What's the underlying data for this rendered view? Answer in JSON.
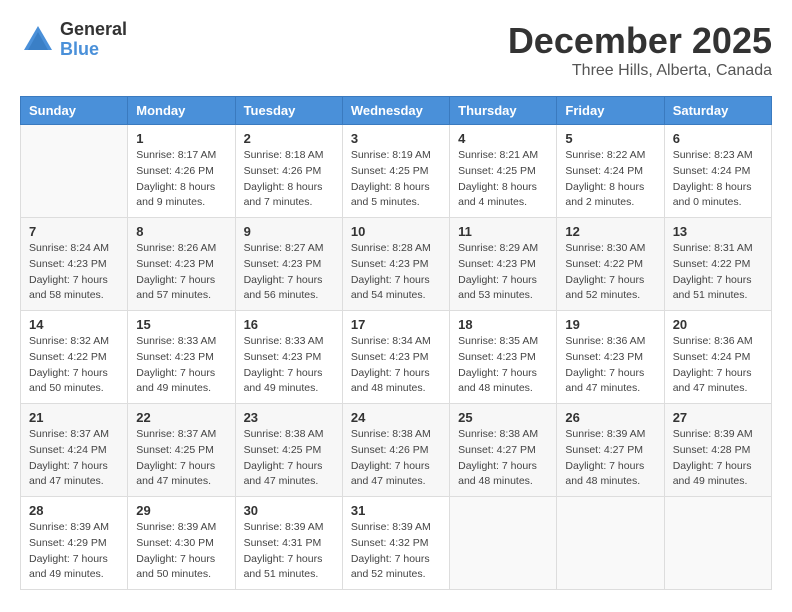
{
  "logo": {
    "general": "General",
    "blue": "Blue"
  },
  "title": "December 2025",
  "location": "Three Hills, Alberta, Canada",
  "days_of_week": [
    "Sunday",
    "Monday",
    "Tuesday",
    "Wednesday",
    "Thursday",
    "Friday",
    "Saturday"
  ],
  "weeks": [
    [
      {
        "day": "",
        "info": ""
      },
      {
        "day": "1",
        "info": "Sunrise: 8:17 AM\nSunset: 4:26 PM\nDaylight: 8 hours\nand 9 minutes."
      },
      {
        "day": "2",
        "info": "Sunrise: 8:18 AM\nSunset: 4:26 PM\nDaylight: 8 hours\nand 7 minutes."
      },
      {
        "day": "3",
        "info": "Sunrise: 8:19 AM\nSunset: 4:25 PM\nDaylight: 8 hours\nand 5 minutes."
      },
      {
        "day": "4",
        "info": "Sunrise: 8:21 AM\nSunset: 4:25 PM\nDaylight: 8 hours\nand 4 minutes."
      },
      {
        "day": "5",
        "info": "Sunrise: 8:22 AM\nSunset: 4:24 PM\nDaylight: 8 hours\nand 2 minutes."
      },
      {
        "day": "6",
        "info": "Sunrise: 8:23 AM\nSunset: 4:24 PM\nDaylight: 8 hours\nand 0 minutes."
      }
    ],
    [
      {
        "day": "7",
        "info": "Sunrise: 8:24 AM\nSunset: 4:23 PM\nDaylight: 7 hours\nand 58 minutes."
      },
      {
        "day": "8",
        "info": "Sunrise: 8:26 AM\nSunset: 4:23 PM\nDaylight: 7 hours\nand 57 minutes."
      },
      {
        "day": "9",
        "info": "Sunrise: 8:27 AM\nSunset: 4:23 PM\nDaylight: 7 hours\nand 56 minutes."
      },
      {
        "day": "10",
        "info": "Sunrise: 8:28 AM\nSunset: 4:23 PM\nDaylight: 7 hours\nand 54 minutes."
      },
      {
        "day": "11",
        "info": "Sunrise: 8:29 AM\nSunset: 4:23 PM\nDaylight: 7 hours\nand 53 minutes."
      },
      {
        "day": "12",
        "info": "Sunrise: 8:30 AM\nSunset: 4:22 PM\nDaylight: 7 hours\nand 52 minutes."
      },
      {
        "day": "13",
        "info": "Sunrise: 8:31 AM\nSunset: 4:22 PM\nDaylight: 7 hours\nand 51 minutes."
      }
    ],
    [
      {
        "day": "14",
        "info": "Sunrise: 8:32 AM\nSunset: 4:22 PM\nDaylight: 7 hours\nand 50 minutes."
      },
      {
        "day": "15",
        "info": "Sunrise: 8:33 AM\nSunset: 4:23 PM\nDaylight: 7 hours\nand 49 minutes."
      },
      {
        "day": "16",
        "info": "Sunrise: 8:33 AM\nSunset: 4:23 PM\nDaylight: 7 hours\nand 49 minutes."
      },
      {
        "day": "17",
        "info": "Sunrise: 8:34 AM\nSunset: 4:23 PM\nDaylight: 7 hours\nand 48 minutes."
      },
      {
        "day": "18",
        "info": "Sunrise: 8:35 AM\nSunset: 4:23 PM\nDaylight: 7 hours\nand 48 minutes."
      },
      {
        "day": "19",
        "info": "Sunrise: 8:36 AM\nSunset: 4:23 PM\nDaylight: 7 hours\nand 47 minutes."
      },
      {
        "day": "20",
        "info": "Sunrise: 8:36 AM\nSunset: 4:24 PM\nDaylight: 7 hours\nand 47 minutes."
      }
    ],
    [
      {
        "day": "21",
        "info": "Sunrise: 8:37 AM\nSunset: 4:24 PM\nDaylight: 7 hours\nand 47 minutes."
      },
      {
        "day": "22",
        "info": "Sunrise: 8:37 AM\nSunset: 4:25 PM\nDaylight: 7 hours\nand 47 minutes."
      },
      {
        "day": "23",
        "info": "Sunrise: 8:38 AM\nSunset: 4:25 PM\nDaylight: 7 hours\nand 47 minutes."
      },
      {
        "day": "24",
        "info": "Sunrise: 8:38 AM\nSunset: 4:26 PM\nDaylight: 7 hours\nand 47 minutes."
      },
      {
        "day": "25",
        "info": "Sunrise: 8:38 AM\nSunset: 4:27 PM\nDaylight: 7 hours\nand 48 minutes."
      },
      {
        "day": "26",
        "info": "Sunrise: 8:39 AM\nSunset: 4:27 PM\nDaylight: 7 hours\nand 48 minutes."
      },
      {
        "day": "27",
        "info": "Sunrise: 8:39 AM\nSunset: 4:28 PM\nDaylight: 7 hours\nand 49 minutes."
      }
    ],
    [
      {
        "day": "28",
        "info": "Sunrise: 8:39 AM\nSunset: 4:29 PM\nDaylight: 7 hours\nand 49 minutes."
      },
      {
        "day": "29",
        "info": "Sunrise: 8:39 AM\nSunset: 4:30 PM\nDaylight: 7 hours\nand 50 minutes."
      },
      {
        "day": "30",
        "info": "Sunrise: 8:39 AM\nSunset: 4:31 PM\nDaylight: 7 hours\nand 51 minutes."
      },
      {
        "day": "31",
        "info": "Sunrise: 8:39 AM\nSunset: 4:32 PM\nDaylight: 7 hours\nand 52 minutes."
      },
      {
        "day": "",
        "info": ""
      },
      {
        "day": "",
        "info": ""
      },
      {
        "day": "",
        "info": ""
      }
    ]
  ]
}
